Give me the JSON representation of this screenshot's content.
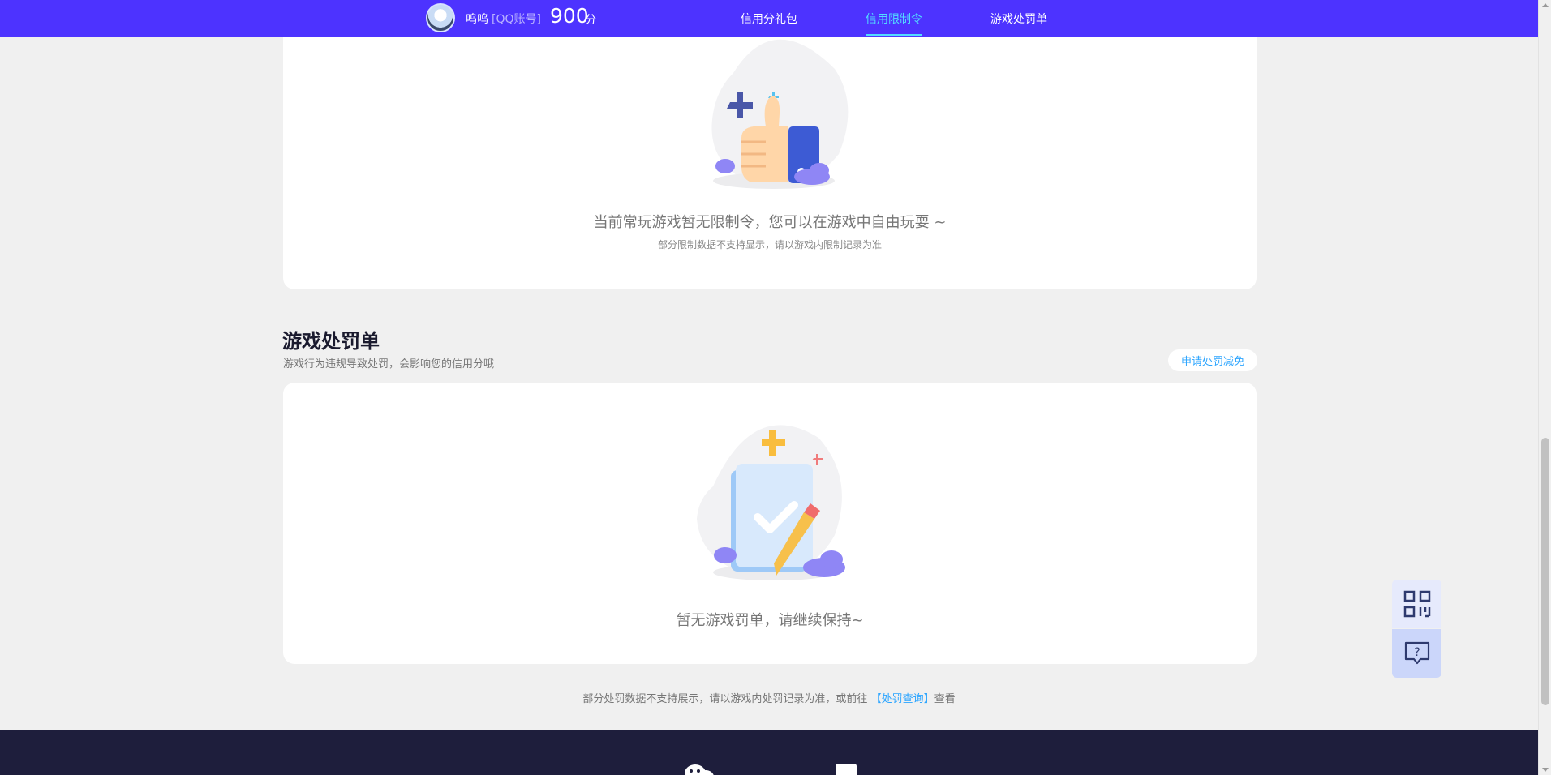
{
  "header": {
    "username": "呜呜",
    "account_type": "[QQ账号]",
    "score": "900",
    "score_unit": "分",
    "nav": [
      {
        "label": "信用分礼包",
        "active": false
      },
      {
        "label": "信用限制令",
        "active": true
      },
      {
        "label": "游戏处罚单",
        "active": false
      }
    ],
    "accent_color": "#4d33ff",
    "active_color": "#52dcff"
  },
  "restriction": {
    "empty_main": "当前常玩游戏暂无限制令，您可以在游戏中自由玩耍 ~",
    "empty_sub": "部分限制数据不支持显示，请以游戏内限制记录为准",
    "illustration_icon": "thumbs-up-icon"
  },
  "penalty": {
    "title": "游戏处罚单",
    "description": "游戏行为违规导致处罚，会影响您的信用分哦",
    "appeal_button": "申请处罚减免",
    "empty_main": "暂无游戏罚单，请继续保持~",
    "illustration_icon": "checklist-pencil-icon"
  },
  "footnote": {
    "before": "部分处罚数据不支持展示，请以游戏内处罚记录为准，或前往",
    "link": "【处罚查询】",
    "after": "查看"
  },
  "float": {
    "qr_icon": "qrcode-icon",
    "help_icon": "help-chat-icon"
  },
  "footer": {
    "icons": [
      "wechat-icon",
      "mini-program-icon"
    ]
  }
}
